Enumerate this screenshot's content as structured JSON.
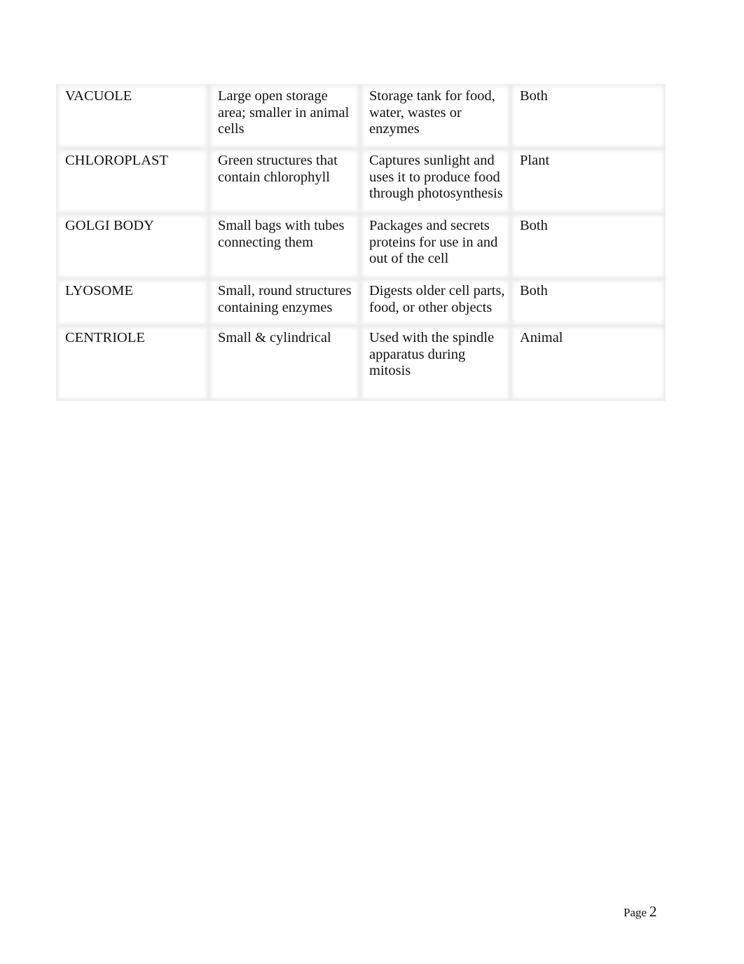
{
  "table": {
    "rows": [
      {
        "organelle": "VACUOLE",
        "description": "Large open storage area; smaller in animal cells",
        "function": "Storage tank for food, water, wastes or enzymes",
        "cell_type": "Both"
      },
      {
        "organelle": "CHLOROPLAST",
        "description": "Green structures that contain chlorophyll",
        "function": "Captures sunlight and uses it to produce food through photosynthesis",
        "cell_type": "Plant"
      },
      {
        "organelle": "GOLGI BODY",
        "description": "Small bags with tubes connecting them",
        "function": "Packages and secrets proteins for use in and out of the cell",
        "cell_type": "Both"
      },
      {
        "organelle": "LYOSOME",
        "description": "Small, round structures containing enzymes",
        "function": "Digests older cell parts, food, or other objects",
        "cell_type": "Both"
      },
      {
        "organelle": "CENTRIOLE",
        "description": "Small & cylindrical",
        "function": "Used with the spindle apparatus during mitosis",
        "cell_type": "Animal"
      }
    ]
  },
  "footer": {
    "page_label": "Page",
    "page_number": "2"
  }
}
